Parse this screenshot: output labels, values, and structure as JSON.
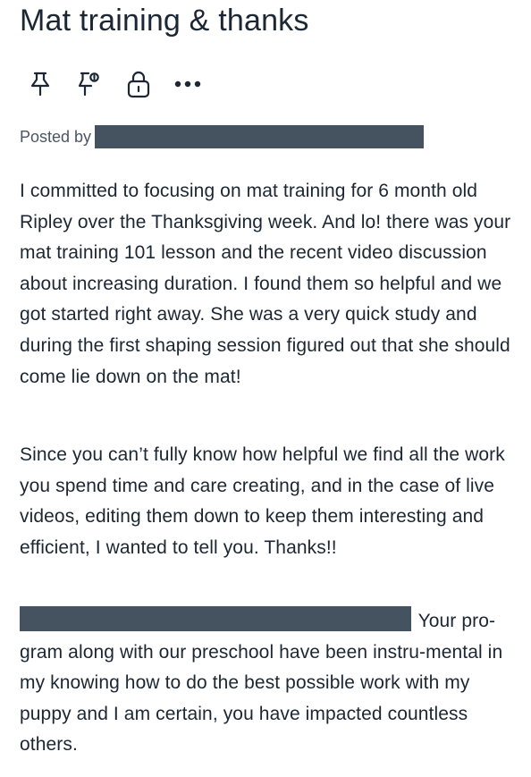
{
  "post": {
    "title": "Mat training & thanks",
    "posted_by_label": "Posted by",
    "paragraphs": [
      "I committed to focusing on mat training for 6 month old Ripley over the Thanksgiving week. And lo! there was your mat training 101 lesson and the recent video discussion about increasing duration. I found them so helpful and we got started right away. She was a very quick study and during the first shaping session figured out that she should come lie down on the mat!",
      "Since you can’t fully know how helpful we find all the work you spend time and care creating, and in the case of live videos, editing them down to keep them interesting and efficient, I wanted to tell you. Thanks!!",
      "Your pro-gram along with our preschool have been instru-mental in my knowing how to do the best possible work with my puppy and I am certain, you have impacted countless others."
    ]
  },
  "toolbar": {
    "icons": [
      "pin-icon",
      "unpin-icon",
      "lock-icon",
      "more-icon"
    ]
  },
  "colors": {
    "text": "#1c2733",
    "redaction": "#45525f",
    "muted": "#4b5563"
  }
}
